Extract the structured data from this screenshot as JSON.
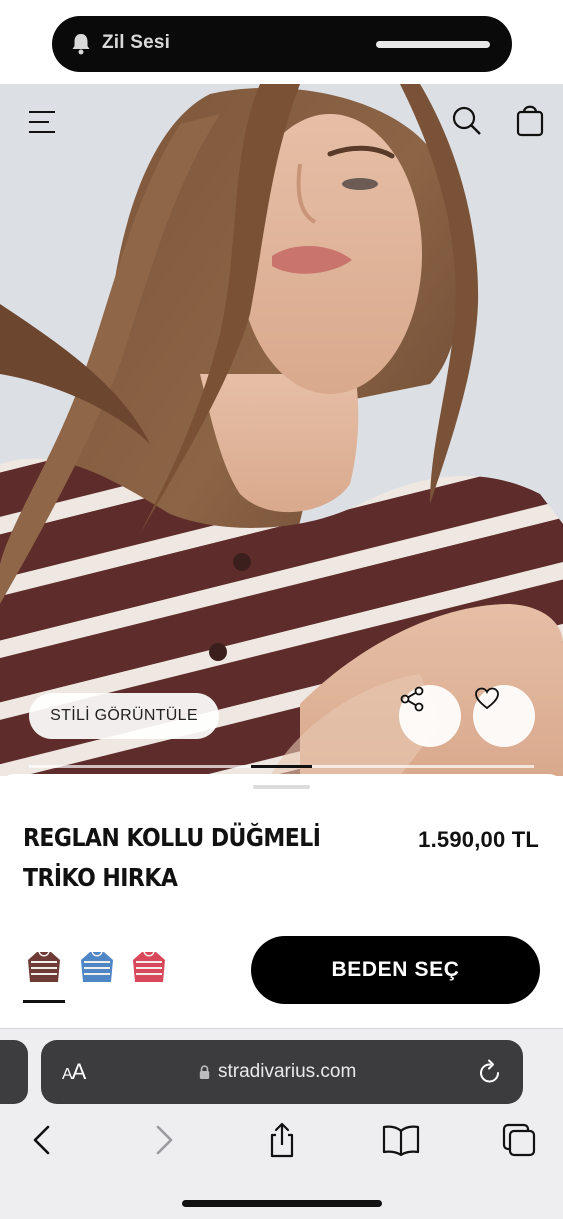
{
  "status": {
    "live_activity_title": "Zil Sesi"
  },
  "product": {
    "title": "REGLAN KOLLU DÜĞMELİ TRİKO HIRKA",
    "price": "1.590,00 TL",
    "view_style_label": "STİLİ GÖRÜNTÜLE",
    "size_button_label": "BEDEN SEÇ",
    "swatches": [
      {
        "name": "maroon-stripe",
        "color": "#6e3b36",
        "selected": true
      },
      {
        "name": "blue-stripe",
        "color": "#4f86c6",
        "selected": false
      },
      {
        "name": "red-stripe",
        "color": "#d9485a",
        "selected": false
      }
    ],
    "gallery": {
      "image_count": 5,
      "current_image": 3
    }
  },
  "browser": {
    "text_size_label_small": "A",
    "text_size_label_large": "A",
    "url": "stradivarius.com"
  },
  "colors": {
    "accent": "#000000",
    "sheet_bg": "#ffffff",
    "browser_bar": "#3c3c3e",
    "sweater_brown": "#5e2c2a",
    "sweater_stripe": "#efe8e2"
  },
  "icons": [
    "bell-icon",
    "menu-icon",
    "search-icon",
    "bag-icon",
    "share-icon",
    "heart-icon",
    "lock-icon",
    "reload-icon",
    "back-icon",
    "forward-icon",
    "share-sheet-icon",
    "bookmarks-icon",
    "tabs-icon"
  ]
}
